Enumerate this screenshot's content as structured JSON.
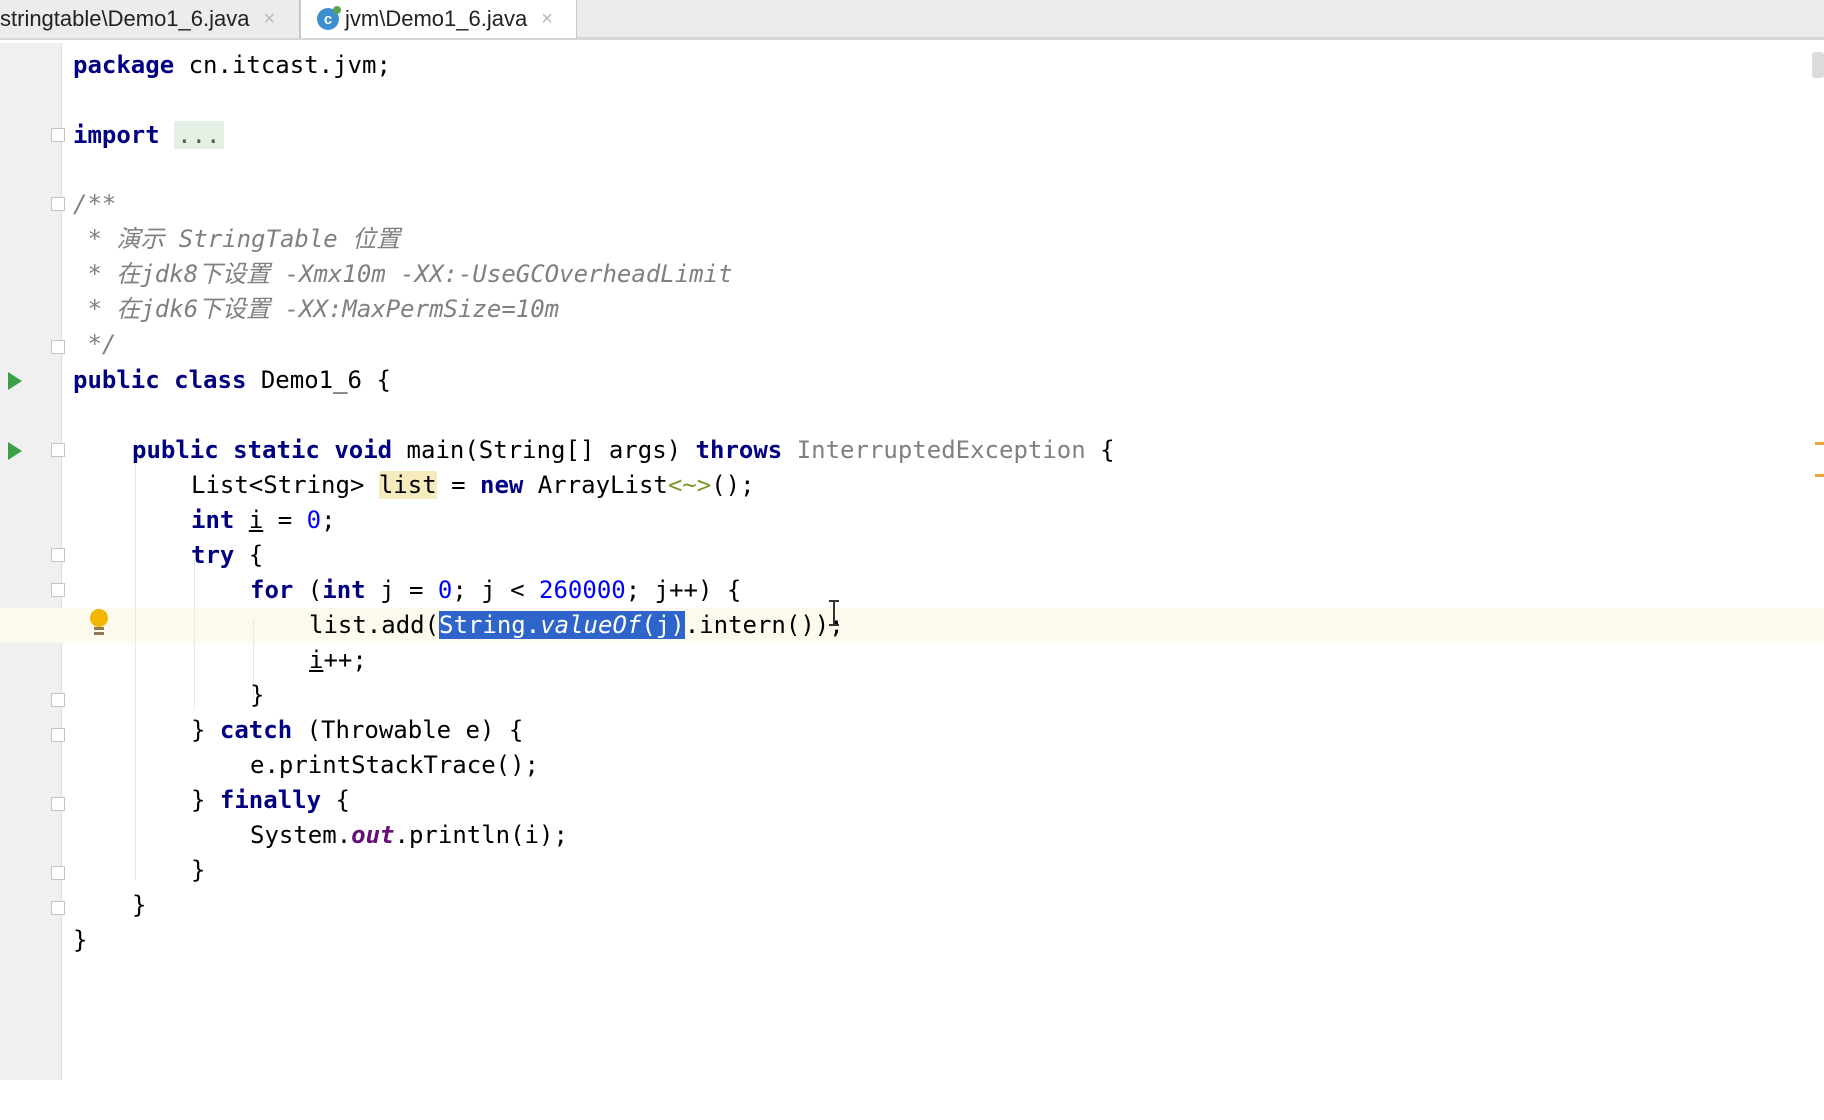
{
  "tabs": [
    {
      "label": "stringtable\\Demo1_6.java",
      "active": false,
      "close": "×"
    },
    {
      "label": "jvm\\Demo1_6.java",
      "active": true,
      "close": "×",
      "icon": "class-icon"
    }
  ],
  "code": {
    "l1": {
      "kw": "package",
      "rest": " cn.itcast.jvm;"
    },
    "l2": {
      "kw": "import",
      "folded": "..."
    },
    "l3": "/**",
    "l4": " * 演示 StringTable 位置",
    "l5": " * 在jdk8下设置 -Xmx10m -XX:-UseGCOverheadLimit",
    "l6": " * 在jdk6下设置 -XX:MaxPermSize=10m",
    "l7": " */",
    "l8": {
      "kw1": "public",
      "kw2": "class",
      "name": " Demo1_6 {"
    },
    "l9": {
      "kw1": "public",
      "kw2": "static",
      "kw3": "void",
      "sig": " main(String[] args) ",
      "throws": "throws",
      "exc": "InterruptedException",
      "tail": " {"
    },
    "l10": {
      "a": "List<String> ",
      "var": "list",
      "b": " = ",
      "kw": "new",
      "c": " ArrayList",
      "diamond": "<~>",
      "d": "();"
    },
    "l11": {
      "kw": "int",
      "var": "i",
      "b": " = ",
      "num": "0",
      "c": ";"
    },
    "l12": {
      "kw": "try",
      "b": " {"
    },
    "l13": {
      "kw": "for",
      "a": " (",
      "kw2": "int",
      "b": " j = ",
      "num1": "0",
      "c": "; j < ",
      "num2": "260000",
      "d": "; j++) {"
    },
    "l14": {
      "a": "list.add(",
      "sel_a": "String.",
      "sel_b": "valueOf",
      "sel_c": "(j)",
      "b": ".intern());"
    },
    "l15": {
      "var": "i",
      "b": "++;"
    },
    "l16": "}",
    "l17": {
      "a": "} ",
      "kw": "catch",
      "b": " (Throwable e) {"
    },
    "l18": "e.printStackTrace();",
    "l19": {
      "a": "} ",
      "kw": "finally",
      "b": " {"
    },
    "l20": {
      "a": "System.",
      "field": "out",
      "b": ".println(i);"
    },
    "l21": "}",
    "l22": "}",
    "l23": "}"
  }
}
